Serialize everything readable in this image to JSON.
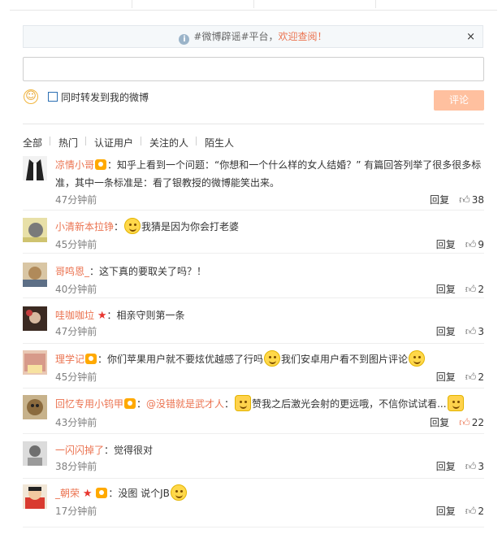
{
  "notice": {
    "text_prefix": "#微博辟谣#平台，",
    "text_link": "欢迎查阅！",
    "close": "×"
  },
  "reply": {
    "value": "",
    "placeholder": ""
  },
  "repost_label": "同时转发到我的微博",
  "submit_label": "评论",
  "filters": [
    "全部",
    "热门",
    "认证用户",
    "关注的人",
    "陌生人"
  ],
  "reply_label": "回复",
  "comments": [
    {
      "user": "凉情小哥",
      "text": "：知乎上看到一个问题：“你想和一个什么样的女人结婚？” 有篇回答列举了很多很多标准，其中一条标准是：看了银教授的微博能笑出来。",
      "time": "47分钟前",
      "likes": "38"
    },
    {
      "user": "小清新本拉铮",
      "text": "我猜是因为你会打老婆",
      "time": "45分钟前",
      "likes": "9"
    },
    {
      "user": "哥鸣恩_",
      "text": "：这下真的要取关了吗？！",
      "time": "40分钟前",
      "likes": "2"
    },
    {
      "user": "哇咖咖垃",
      "text": "：相亲守则第一条",
      "time": "47分钟前",
      "likes": "3"
    },
    {
      "user": "理学记",
      "text_a": "：你们苹果用户就不要炫优越感了行吗",
      "text_b": "我们安卓用户看不到图片评论",
      "time": "45分钟前",
      "likes": "2"
    },
    {
      "user": "回忆专用小钨甲",
      "mention": "@没错就是武才人",
      "text_a": "赞我之后激光会射的更远哦，不信你试试看...",
      "time": "43分钟前",
      "likes": "22"
    },
    {
      "user": "一闪闪掉了",
      "text": "：觉得很对",
      "time": "38分钟前",
      "likes": "3"
    },
    {
      "user": "_朝荣",
      "text": "：没图 说个JB",
      "time": "17分钟前",
      "likes": "2"
    }
  ],
  "colors": {
    "accent": "#eb7350",
    "button": "#ffc09f",
    "muted": "#808080"
  }
}
